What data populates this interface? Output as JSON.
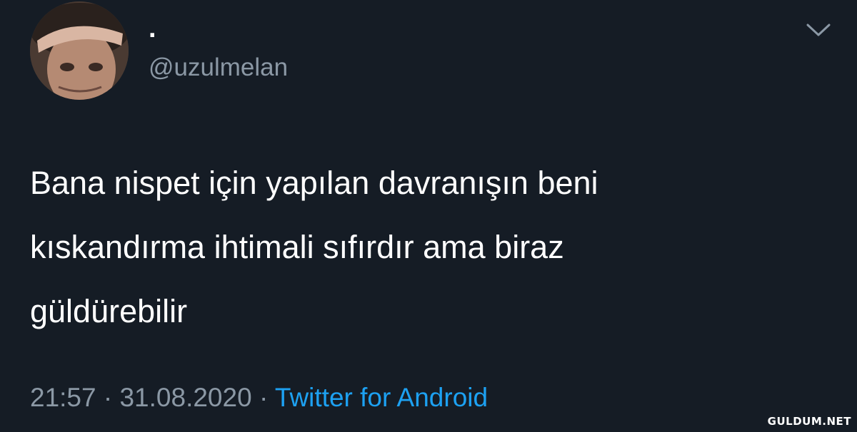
{
  "tweet": {
    "display_name": ".",
    "handle": "@uzulmelan",
    "text": "Bana nispet için yapılan davranışın beni\nkıskandırma ihtimali sıfırdır ama biraz\ngüldürebilir",
    "time": "21:57",
    "separator_1": " · ",
    "date": "31.08.2020",
    "separator_2": " · ",
    "source": "Twitter for Android"
  },
  "icons": {
    "avatar": "avatar-photo",
    "menu": "chevron-down-icon"
  },
  "watermark": "GULDUM.NET",
  "colors": {
    "background": "#151c25",
    "text": "#ffffff",
    "muted": "#8b98a5",
    "link": "#1da1f2"
  }
}
